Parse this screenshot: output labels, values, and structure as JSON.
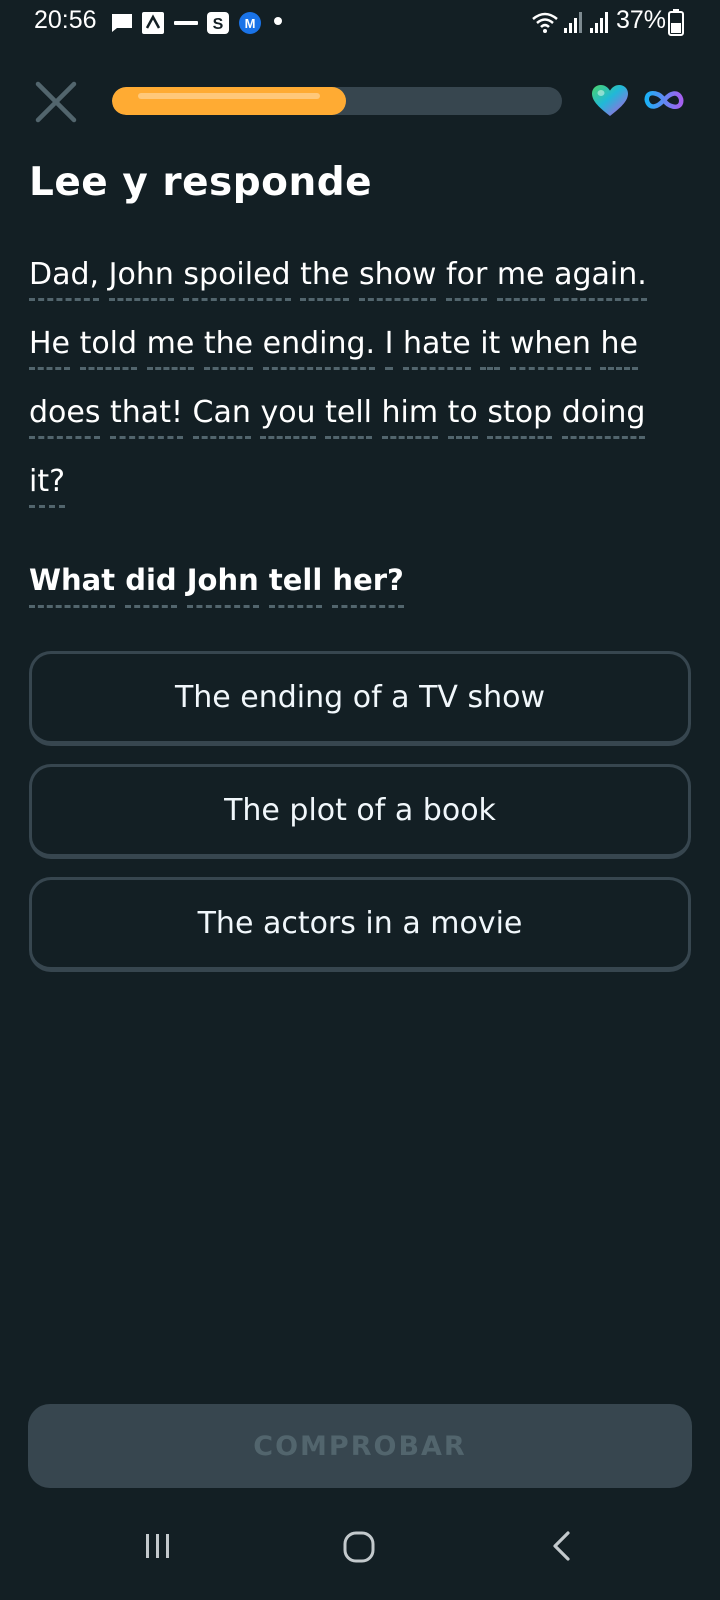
{
  "status_bar": {
    "time": "20:56",
    "battery": "37%",
    "icons": [
      "message-icon",
      "notification-icon",
      "app-icon",
      "s-app-icon",
      "m-app-icon",
      "dot-icon",
      "wifi-icon",
      "signal-icon",
      "signal-icon",
      "battery-icon"
    ]
  },
  "top_bar": {
    "close_icon": "close-icon",
    "progress": 0.52,
    "heart_icon": "heart-icon",
    "hearts": "infinity"
  },
  "lesson": {
    "title": "Lee y responde",
    "passage_lines": [
      [
        "Dad,",
        "John",
        "spoiled",
        "the",
        "show",
        "for",
        "me",
        "again."
      ],
      [
        "He",
        "told",
        "me",
        "the",
        "ending.",
        "I",
        "hate",
        "it",
        "when",
        "he"
      ],
      [
        "does",
        "that!",
        "Can",
        "you",
        "tell",
        "him",
        "to",
        "stop",
        "doing"
      ],
      [
        "it?"
      ]
    ],
    "question_words": [
      "What",
      "did",
      "John",
      "tell",
      "her?"
    ],
    "options": [
      "The ending of a TV show",
      "The plot of a book",
      "The actors in a movie"
    ],
    "check_label": "COMPROBAR"
  },
  "nav_bar": {
    "items": [
      "recent-apps-icon",
      "home-icon",
      "back-icon"
    ]
  },
  "colors": {
    "background": "#131f24",
    "progress_fill": "#ffab33",
    "track": "#37464f",
    "border": "#37464f",
    "disabled_text": "#52656d",
    "accent_blue": "#1cb0f6"
  }
}
